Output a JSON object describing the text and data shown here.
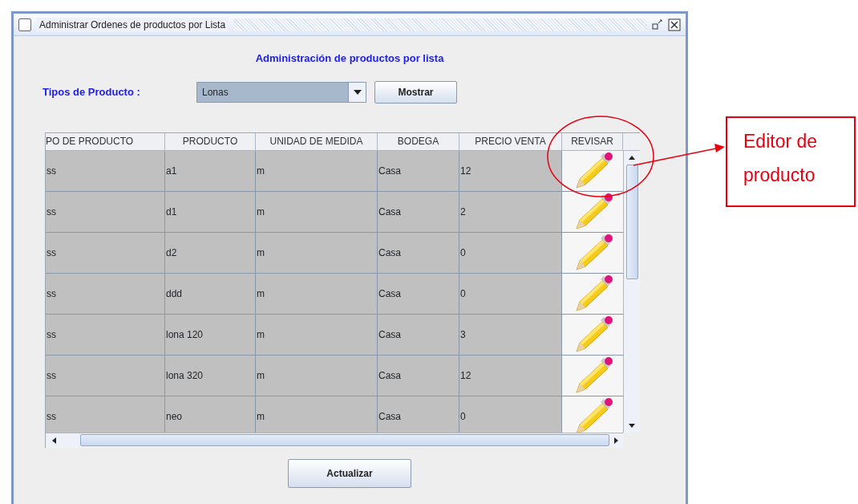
{
  "window": {
    "title": "Administrar Ordenes de productos por Lista"
  },
  "heading": "Administración de productos  por lista",
  "filter": {
    "label": "Tipos de Producto :",
    "value": "Lonas",
    "button": "Mostrar"
  },
  "table": {
    "columns": [
      "PO DE PRODUCTO",
      "PRODUCTO",
      "UNIDAD DE MEDIDA",
      "BODEGA",
      "PRECIO VENTA",
      "REVISAR"
    ],
    "rows": [
      {
        "cells": [
          "ss",
          "a1",
          "m",
          "Casa",
          "12"
        ]
      },
      {
        "cells": [
          "ss",
          "d1",
          "m",
          "Casa",
          "2"
        ]
      },
      {
        "cells": [
          "ss",
          "d2",
          "m",
          "Casa",
          "0"
        ]
      },
      {
        "cells": [
          "ss",
          "ddd",
          "m",
          "Casa",
          "0"
        ]
      },
      {
        "cells": [
          "ss",
          "lona 120",
          "m",
          "Casa",
          "3"
        ]
      },
      {
        "cells": [
          "ss",
          "lona 320",
          "m",
          "Casa",
          "12"
        ]
      },
      {
        "cells": [
          "ss",
          "neo",
          "m",
          "Casa",
          "0"
        ]
      }
    ]
  },
  "update_button": "Actualizar",
  "annotation": {
    "text": "Editor de producto"
  }
}
